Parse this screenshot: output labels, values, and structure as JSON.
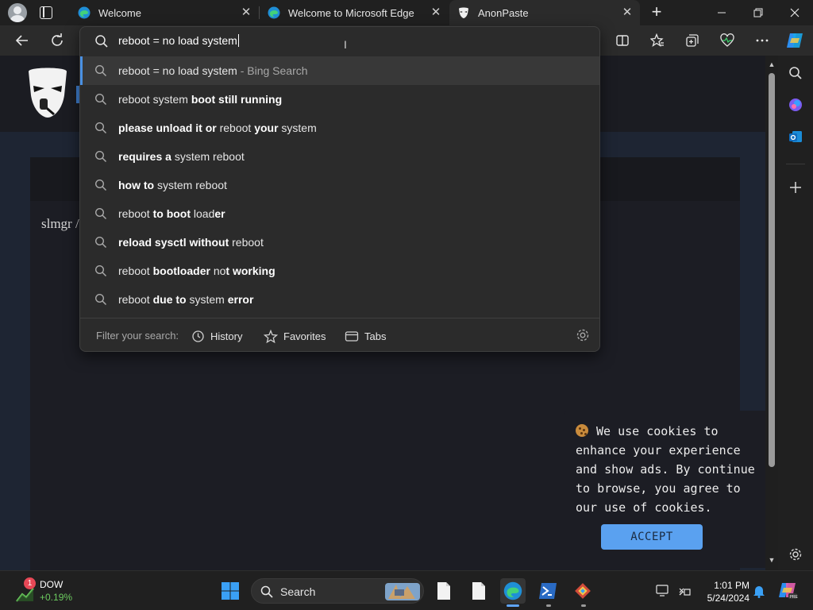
{
  "tabs": [
    {
      "title": "Welcome",
      "close": "✕",
      "active": false
    },
    {
      "title": "Welcome to Microsoft Edge",
      "close": "✕",
      "active": false
    },
    {
      "title": "AnonPaste",
      "close": "✕",
      "active": true
    }
  ],
  "new_tab_label": "+",
  "omnibox": {
    "query": "reboot = no load system",
    "suggestions": [
      {
        "parts": [
          {
            "t": "reboot = no load system",
            "b": false
          },
          {
            "t": " - Bing Search",
            "b": false,
            "muted": true
          }
        ]
      },
      {
        "parts": [
          {
            "t": "reboot system ",
            "b": false
          },
          {
            "t": "boot still running",
            "b": true
          }
        ]
      },
      {
        "parts": [
          {
            "t": "please unload it or ",
            "b": true
          },
          {
            "t": "reboot ",
            "b": false
          },
          {
            "t": "your ",
            "b": true
          },
          {
            "t": "system",
            "b": false
          }
        ]
      },
      {
        "parts": [
          {
            "t": "requires a ",
            "b": true
          },
          {
            "t": "system reboot",
            "b": false
          }
        ]
      },
      {
        "parts": [
          {
            "t": "how to ",
            "b": true
          },
          {
            "t": "system reboot",
            "b": false
          }
        ]
      },
      {
        "parts": [
          {
            "t": "reboot ",
            "b": false
          },
          {
            "t": "to boot ",
            "b": true
          },
          {
            "t": "load",
            "b": false
          },
          {
            "t": "er",
            "b": true
          }
        ]
      },
      {
        "parts": [
          {
            "t": "reload sysctl without ",
            "b": true
          },
          {
            "t": "reboot",
            "b": false
          }
        ]
      },
      {
        "parts": [
          {
            "t": "reboot ",
            "b": false
          },
          {
            "t": "bootloader ",
            "b": true
          },
          {
            "t": "no",
            "b": false
          },
          {
            "t": "t working",
            "b": true
          }
        ]
      },
      {
        "parts": [
          {
            "t": "reboot ",
            "b": false
          },
          {
            "t": "due to ",
            "b": true
          },
          {
            "t": "system ",
            "b": false
          },
          {
            "t": "error",
            "b": true
          }
        ]
      }
    ],
    "filter_label": "Filter your search:",
    "filters": {
      "history": "History",
      "favorites": "Favorites",
      "tabs": "Tabs"
    }
  },
  "page": {
    "paste_text": "slmgr /"
  },
  "cookie": {
    "text": "We use cookies to enhance your experience and show ads. By continue to browse, you agree to our use of cookies.",
    "accept": "ACCEPT"
  },
  "taskbar": {
    "widget_badge": "1",
    "widget_name": "DOW",
    "widget_value": "+0.19%",
    "search_label": "Search",
    "time": "1:01 PM",
    "date": "5/24/2024"
  },
  "colors": {
    "accent": "#4a90e2",
    "accept_button": "#5aa1f0",
    "stock_up": "#6ccb5f"
  }
}
